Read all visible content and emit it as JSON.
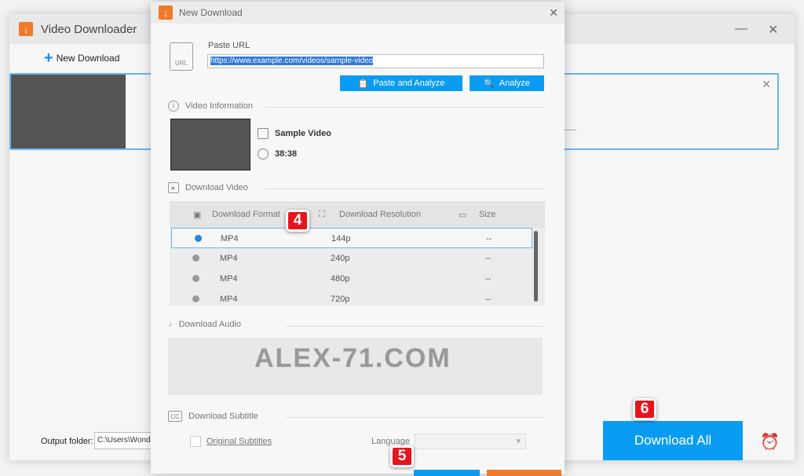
{
  "main_window": {
    "title": "Video Downloader",
    "minimize_glyph": "—",
    "close_glyph": "✕",
    "new_download_label": "New Download",
    "task_close_glyph": "✕",
    "output_folder_label": "Output folder:",
    "output_folder_value": "C:\\Users\\Wonde",
    "download_all_label": "Download All",
    "alarm_glyph": "⏰"
  },
  "dialog": {
    "title": "New Download",
    "close_glyph": "✕",
    "paste_url_label": "Paste URL",
    "url_value": "https://www.example.com/videos/sample-video",
    "url_icon_text": "URL",
    "paste_analyze_label": "Paste and Analyze",
    "analyze_label": "Analyze",
    "video_info_label": "Video Information",
    "video_title": "Sample Video",
    "video_duration": "38:38",
    "download_video_label": "Download Video",
    "table_headers": {
      "format": "Download Format",
      "resolution": "Download Resolution",
      "size": "Size"
    },
    "formats": [
      {
        "format": "MP4",
        "resolution": "144p",
        "size": "--",
        "selected": true
      },
      {
        "format": "MP4",
        "resolution": "240p",
        "size": "--",
        "selected": false
      },
      {
        "format": "MP4",
        "resolution": "480p",
        "size": "--",
        "selected": false
      },
      {
        "format": "MP4",
        "resolution": "720p",
        "size": "--",
        "selected": false
      }
    ],
    "download_audio_label": "Download Audio",
    "download_subtitle_label": "Download Subtitle",
    "original_subtitles_label": "Original Subtitles",
    "language_label": "Language",
    "language_value": ""
  },
  "watermark": "ALEX-71.COM",
  "step_badges": [
    "4",
    "5",
    "6"
  ],
  "colors": {
    "accent_blue": "#0a9cf2",
    "accent_orange": "#f07a2a",
    "badge_red": "#e8141c"
  }
}
